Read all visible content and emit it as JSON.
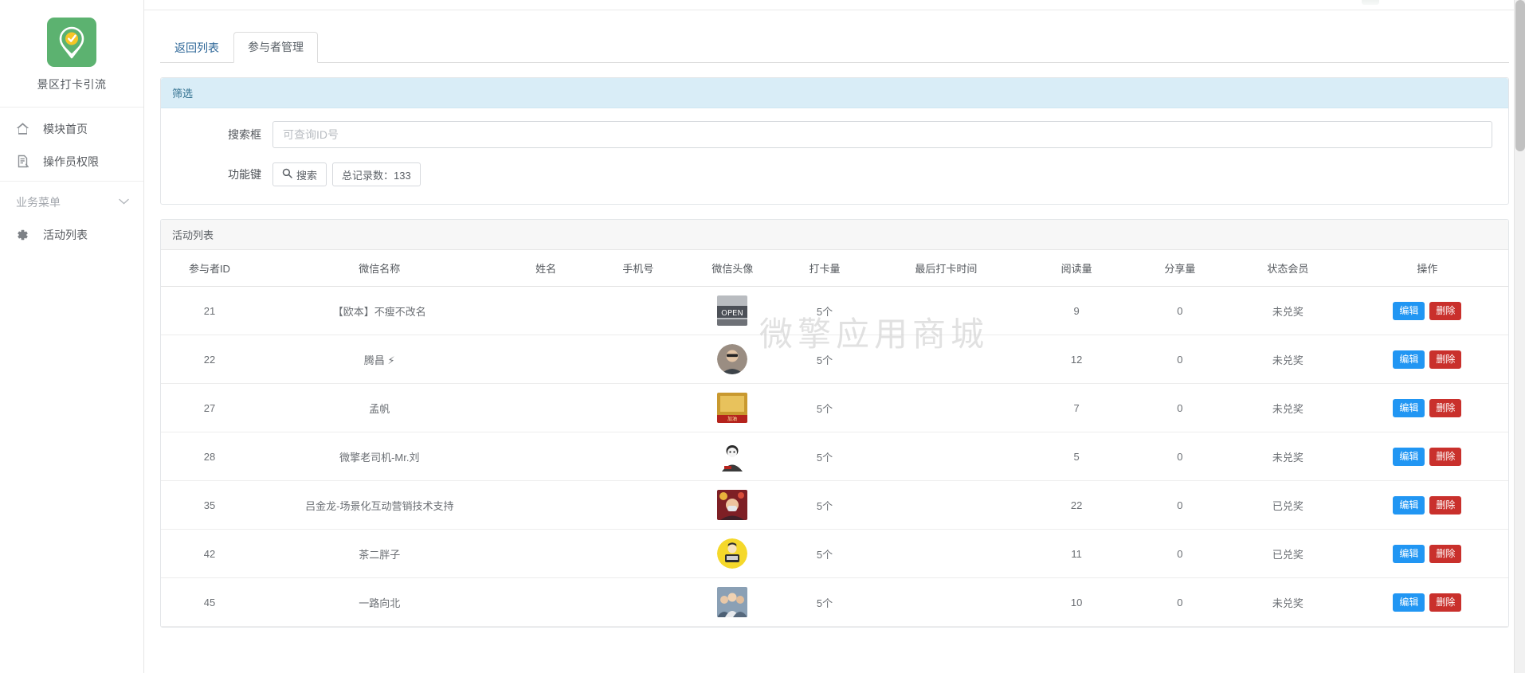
{
  "sidebar": {
    "brand": {
      "name": "景区打卡引流",
      "logo_icon": "location-check-icon",
      "logo_color": "#5cb270"
    },
    "items": [
      {
        "label": "模块首页",
        "icon": "home-icon"
      },
      {
        "label": "操作员权限",
        "icon": "permission-doc-icon"
      }
    ],
    "section": {
      "label": "业务菜单",
      "icon": "chevron-down-icon"
    },
    "section_items": [
      {
        "label": "活动列表",
        "icon": "gear-icon"
      }
    ]
  },
  "tabs": [
    {
      "label": "返回列表",
      "active": false
    },
    {
      "label": "参与者管理",
      "active": true
    }
  ],
  "filter": {
    "title": "筛选",
    "search_label": "搜索框",
    "search_value": "",
    "search_placeholder": "可查询ID号",
    "function_label": "功能键",
    "search_button": "搜索",
    "search_icon": "magnifier-icon",
    "total_label": "总记录数：133",
    "total_count": 133
  },
  "list_panel": {
    "title": "活动列表"
  },
  "table": {
    "columns": [
      "参与者ID",
      "微信名称",
      "姓名",
      "手机号",
      "微信头像",
      "打卡量",
      "最后打卡时间",
      "阅读量",
      "分享量",
      "状态会员",
      "操作"
    ],
    "rows": [
      {
        "id": "21",
        "wechat_name": "【欧本】不瘦不改名",
        "real_name": "",
        "phone": "",
        "avatar": "open-sign-photo",
        "checkins": "5个",
        "last_checkin": "",
        "reads": "9",
        "shares": "0",
        "status": "未兑奖"
      },
      {
        "id": "22",
        "wechat_name": "腾昌 ⚡",
        "real_name": "",
        "phone": "",
        "avatar": "man-sunglasses-photo",
        "checkins": "5个",
        "last_checkin": "",
        "reads": "12",
        "shares": "0",
        "status": "未兑奖"
      },
      {
        "id": "27",
        "wechat_name": "孟帆",
        "real_name": "",
        "phone": "",
        "avatar": "gold-poster-photo",
        "checkins": "5个",
        "last_checkin": "",
        "reads": "7",
        "shares": "0",
        "status": "未兑奖"
      },
      {
        "id": "28",
        "wechat_name": "微擎老司机-Mr.刘",
        "real_name": "",
        "phone": "",
        "avatar": "cartoon-man-photo",
        "checkins": "5个",
        "last_checkin": "",
        "reads": "5",
        "shares": "0",
        "status": "未兑奖"
      },
      {
        "id": "35",
        "wechat_name": "吕金龙-场景化互动营销技术支持",
        "real_name": "",
        "phone": "",
        "avatar": "festival-portrait-photo",
        "checkins": "5个",
        "last_checkin": "",
        "reads": "22",
        "shares": "0",
        "status": "已兑奖"
      },
      {
        "id": "42",
        "wechat_name": "茶二胖子",
        "real_name": "",
        "phone": "",
        "avatar": "yellow-cartoon-photo",
        "checkins": "5个",
        "last_checkin": "",
        "reads": "11",
        "shares": "0",
        "status": "已兑奖"
      },
      {
        "id": "45",
        "wechat_name": "一路向北",
        "real_name": "",
        "phone": "",
        "avatar": "group-people-photo",
        "checkins": "5个",
        "last_checkin": "",
        "reads": "10",
        "shares": "0",
        "status": "未兑奖"
      }
    ],
    "actions": {
      "edit": "编辑",
      "delete": "删除"
    }
  },
  "watermark": "微擎应用商城",
  "colors": {
    "brand_green": "#5cb270",
    "edit_blue": "#2196f3",
    "delete_red": "#c9302c",
    "filter_header_bg": "#d9edf7",
    "filter_header_text": "#31708f"
  }
}
